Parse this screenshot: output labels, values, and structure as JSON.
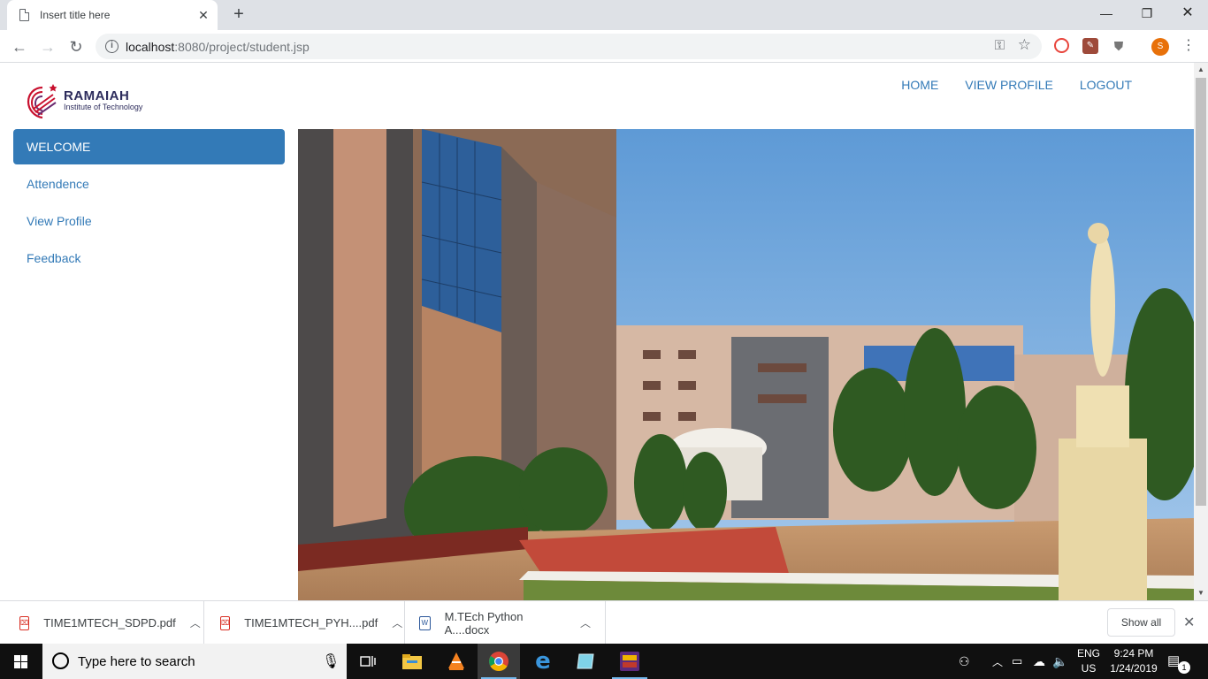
{
  "browser": {
    "tab_title": "Insert title here",
    "tab_close": "✕",
    "new_tab": "+",
    "url_host": "localhost",
    "url_rest": ":8080/project/student.jsp",
    "avatar_letter": "S"
  },
  "site": {
    "brand": "RAMAIAH",
    "brand_sub": "Institute of Technology",
    "nav": {
      "home": "HOME",
      "view_profile": "VIEW PROFILE",
      "logout": "LOGOUT"
    },
    "sidebar": {
      "welcome": "WELCOME",
      "attendence": "Attendence",
      "view_profile": "View Profile",
      "feedback": "Feedback"
    }
  },
  "downloads": {
    "items": [
      {
        "name": "TIME1MTECH_SDPD.pdf",
        "type": "pdf"
      },
      {
        "name": "TIME1MTECH_PYH....pdf",
        "type": "pdf"
      },
      {
        "name": "M.TEch Python A....docx",
        "type": "docx"
      }
    ],
    "show_all": "Show all"
  },
  "taskbar": {
    "search_placeholder": "Type here to search",
    "lang_top": "ENG",
    "lang_bottom": "US",
    "time": "9:24 PM",
    "date": "1/24/2019",
    "notification_count": "1"
  },
  "colors": {
    "accent": "#337ab7",
    "brand_text": "#2d2c5c",
    "brand_red": "#c8102e"
  }
}
